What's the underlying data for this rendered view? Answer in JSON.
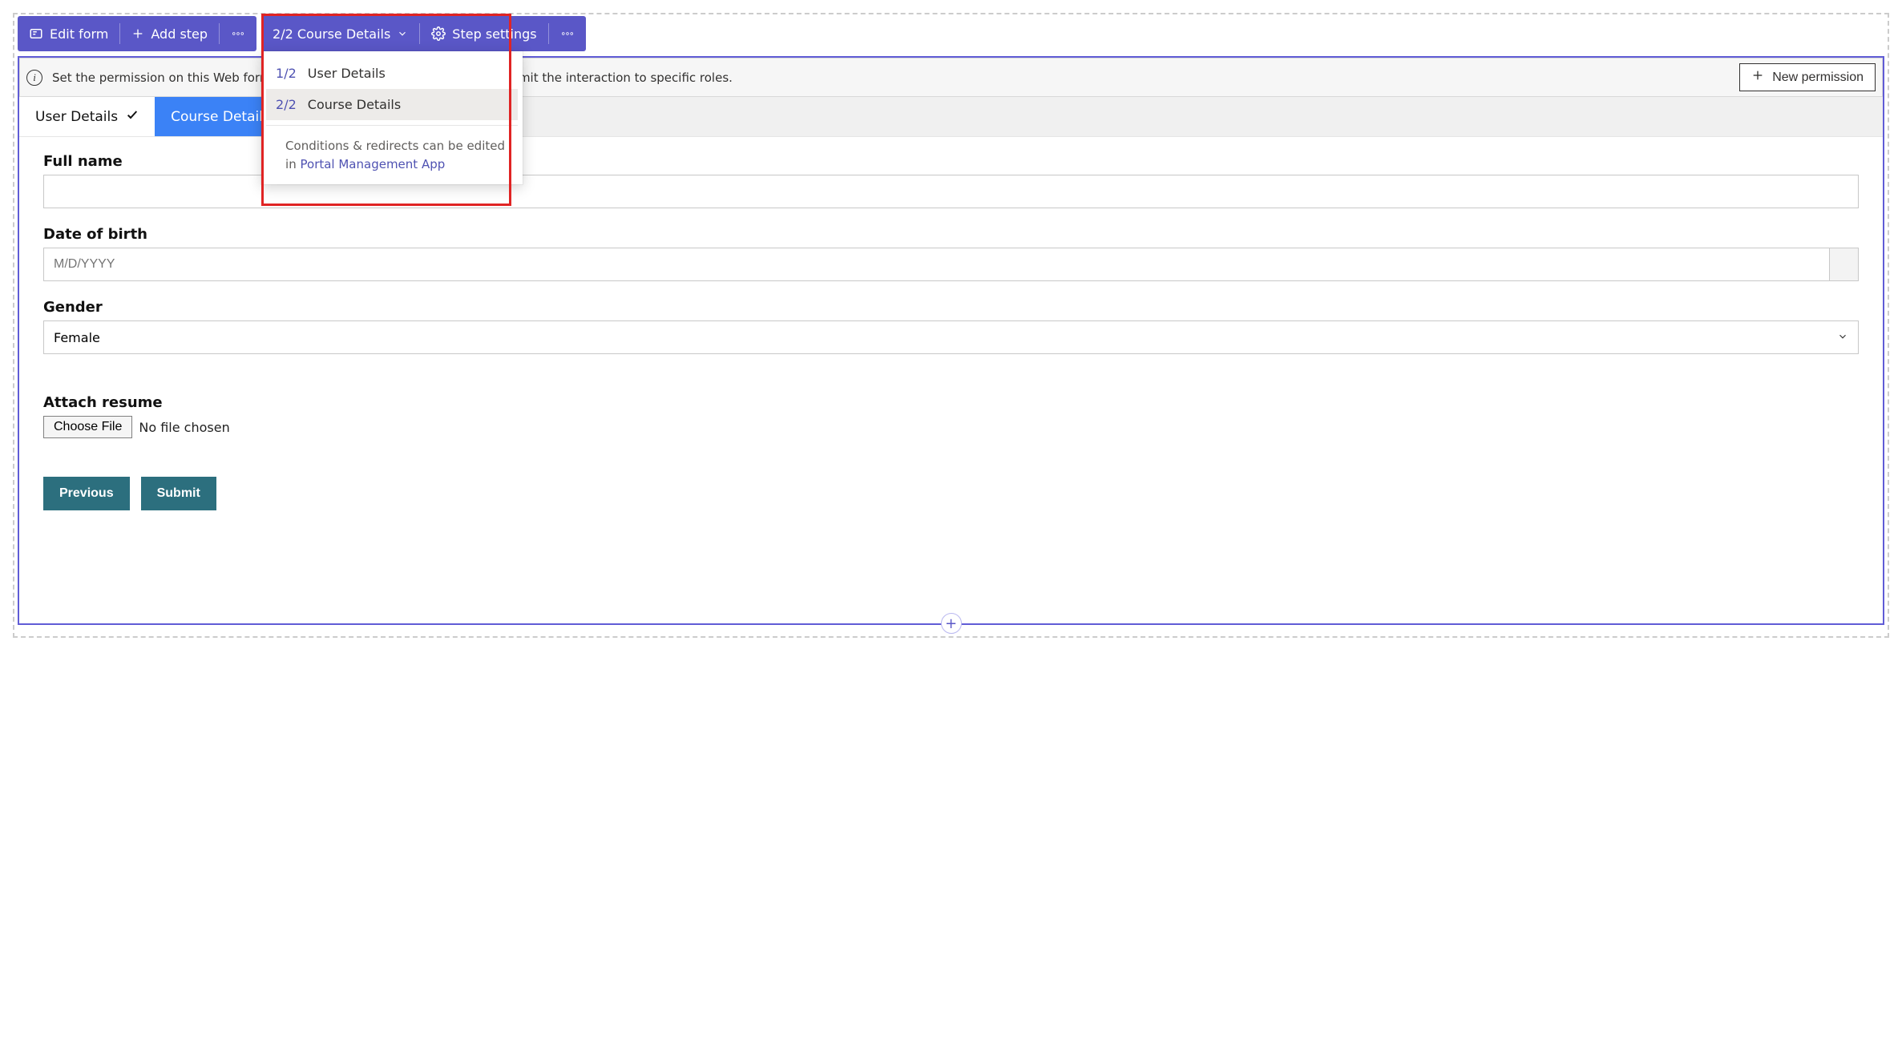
{
  "toolbar": {
    "edit_form": "Edit form",
    "add_step": "Add step",
    "step_dropdown_label": "2/2 Course Details",
    "step_settings": "Step settings"
  },
  "step_dropdown": {
    "items": [
      {
        "idx": "1/2",
        "label": "User Details"
      },
      {
        "idx": "2/2",
        "label": "Course Details"
      }
    ],
    "footer_text": "Conditions & redirects can be edited in ",
    "footer_link": "Portal Management App"
  },
  "info_bar": {
    "text_pre": "Set the permission on this Web form so it can",
    "text_post": " limit the interaction to specific roles.",
    "new_permission": "New permission"
  },
  "tabs": {
    "user_details": "User Details",
    "course_details": "Course Details"
  },
  "fields": {
    "full_name": {
      "label": "Full name",
      "value": ""
    },
    "dob": {
      "label": "Date of birth",
      "placeholder": "M/D/YYYY"
    },
    "gender": {
      "label": "Gender",
      "value": "Female"
    },
    "resume": {
      "label": "Attach resume",
      "button": "Choose File",
      "status": "No file chosen"
    }
  },
  "actions": {
    "previous": "Previous",
    "submit": "Submit"
  }
}
